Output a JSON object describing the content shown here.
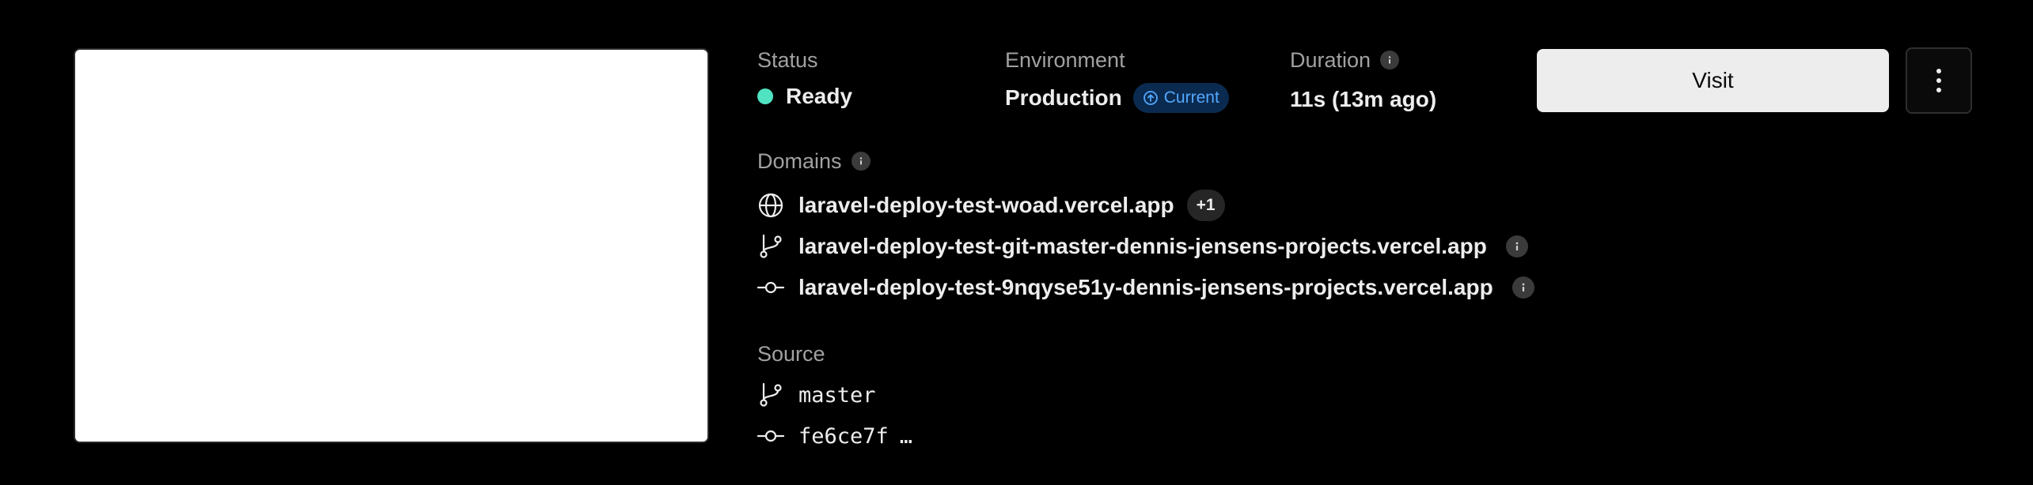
{
  "status": {
    "label": "Status",
    "value": "Ready",
    "color": "#50e3c2"
  },
  "environment": {
    "label": "Environment",
    "value": "Production",
    "badge": "Current",
    "badge_color": "#52a8ff"
  },
  "duration": {
    "label": "Duration",
    "value": "11s (13m ago)"
  },
  "actions": {
    "visit_label": "Visit",
    "menu_icon": "more-vertical-icon"
  },
  "domains": {
    "label": "Domains",
    "items": [
      {
        "icon": "globe-icon",
        "text": "laravel-deploy-test-woad.vercel.app",
        "extra": "+1"
      },
      {
        "icon": "git-branch-icon",
        "text": "laravel-deploy-test-git-master-dennis-jensens-projects.vercel.app"
      },
      {
        "icon": "git-commit-icon",
        "text": "laravel-deploy-test-9nqyse51y-dennis-jensens-projects.vercel.app"
      }
    ]
  },
  "source": {
    "label": "Source",
    "branch": "master",
    "commit": "fe6ce7f",
    "commit_suffix": "…"
  }
}
